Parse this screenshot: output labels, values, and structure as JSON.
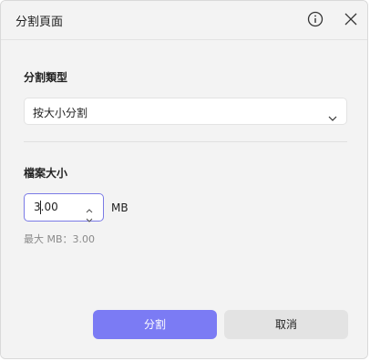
{
  "window": {
    "title": "分割頁面"
  },
  "split_type": {
    "label": "分割類型",
    "selected": "按大小分割"
  },
  "file_size": {
    "label": "檔案大小",
    "value": "3.00",
    "unit": "MB",
    "hint": "最大 MB：3.00"
  },
  "buttons": {
    "split": "分割",
    "cancel": "取消"
  },
  "colors": {
    "accent": "#7b7bf4",
    "input_focus_border": "#7a7ae6",
    "background": "#f3f3f3"
  },
  "icons": {
    "info": "info-circle-icon",
    "close": "close-icon",
    "dropdown": "chevron-down-icon",
    "spin_up": "chevron-up-icon",
    "spin_down": "chevron-down-icon"
  }
}
